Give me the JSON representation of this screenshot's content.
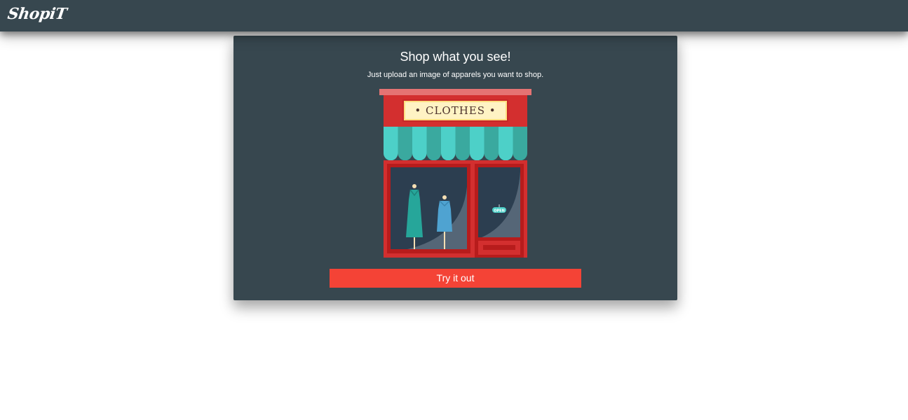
{
  "navbar": {
    "brand": "ShopiT"
  },
  "hero": {
    "title": "Shop what you see!",
    "subtitle": "Just upload an image of apparels you want to shop.",
    "illustration": {
      "sign_text": "• CLOTHES •",
      "open_sign_text": "OPEN"
    },
    "cta_label": "Try it out"
  },
  "colors": {
    "navbar_bg": "#37474f",
    "card_bg": "#37474f",
    "cta_bg": "#f44336",
    "text": "#ffffff"
  }
}
